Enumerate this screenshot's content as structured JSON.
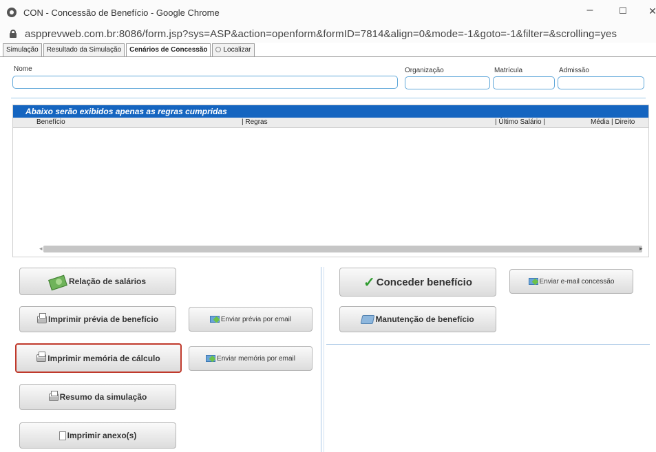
{
  "window": {
    "title": "CON - Concessão de Benefício - Google Chrome",
    "minimize": "–",
    "maximize": "☐",
    "close": "✕"
  },
  "address": {
    "url": "aspprevweb.com.br:8086/form.jsp?sys=ASP&action=openform&formID=7814&align=0&mode=-1&goto=-1&filter=&scrolling=yes"
  },
  "tabs": [
    {
      "label": "Simulação"
    },
    {
      "label": "Resultado da Simulação"
    },
    {
      "label": "Cenários de Concessão"
    },
    {
      "label": "Localizar"
    }
  ],
  "form": {
    "nome_label": "Nome",
    "nome_value": "",
    "organizacao_label": "Organização",
    "organizacao_value": "",
    "matricula_label": "Matrícula",
    "matricula_value": "",
    "admissao_label": "Admissão",
    "admissao_value": ""
  },
  "grid": {
    "header": "Abaixo serão exibidos apenas as regras cumpridas",
    "columns": [
      "Benefício",
      "| Regras",
      "| Último Salário |",
      "Média | Direito"
    ]
  },
  "buttons": {
    "relacao_salarios": "Relação de salários",
    "imprimir_previa": "Imprimir prévia de benefício",
    "enviar_previa": "Enviar prévia por email",
    "imprimir_memoria": "Imprimir memória de cálculo",
    "enviar_memoria": "Enviar memória por email",
    "resumo_simulacao": "Resumo da simulação",
    "imprimir_anexo": "Imprimir anexo(s)",
    "conceder_beneficio": "Conceder benefício",
    "enviar_email_concessao": "Enviar e-mail concessão",
    "manutencao_beneficio": "Manutenção de benefício"
  },
  "colors": {
    "grid_header": "#1565c0",
    "highlight": "#c0392b",
    "field_border": "#5fa7d9"
  }
}
